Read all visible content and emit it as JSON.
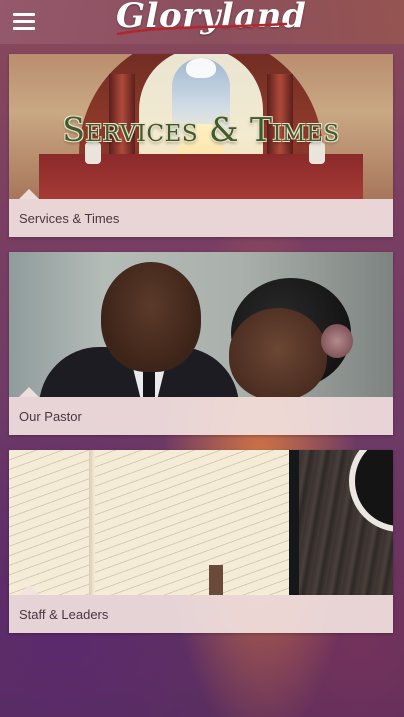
{
  "header": {
    "menu_icon": "hamburger-menu-icon",
    "logo_text": "Gloryland"
  },
  "colors": {
    "caption_bg": "#f2e2e0",
    "caption_text": "#4a3540",
    "header_text": "#ffffff"
  },
  "cards": [
    {
      "label": "Services & Times",
      "image_title": "Services & Times"
    },
    {
      "label": "Our Pastor"
    },
    {
      "label": "Staff & Leaders"
    }
  ]
}
